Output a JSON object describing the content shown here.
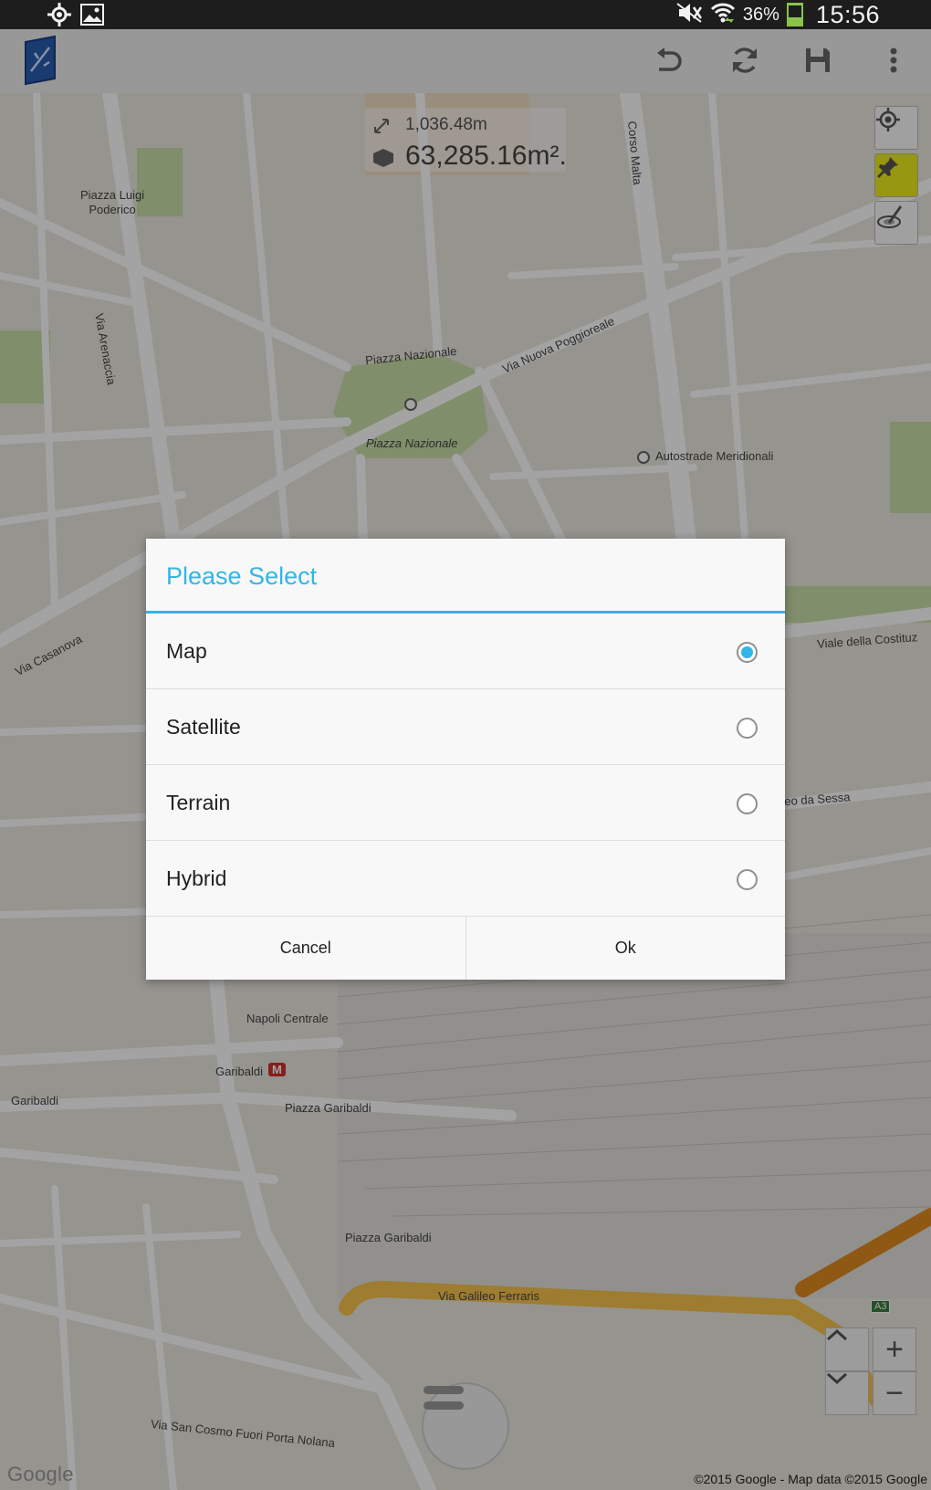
{
  "status_bar": {
    "battery_percent": "36%",
    "battery_level": 0.36,
    "time": "15:56"
  },
  "action_bar": {
    "icons": [
      "app-icon",
      "undo-icon",
      "refresh-icon",
      "save-icon",
      "overflow-menu-icon"
    ]
  },
  "map": {
    "measurement": {
      "length": "1,036.48m",
      "area": "63,285.16m²."
    },
    "labels": {
      "piazza_luigi_poderico": "Piazza Luigi\nPoderico",
      "via_arenaccia": "Via Arenaccia",
      "corso_malta": "Corso Malta",
      "piazza_nazionale_road": "Piazza Nazionale",
      "piazza_nazionale_park": "Piazza Nazionale",
      "via_nuova_poggioreale": "Via Nuova Poggioreale",
      "autostrade_meridionali": "Autostrade Meridionali",
      "via_casanova": "Via Casanova",
      "viale_della_costituzione": "Viale della Costituz",
      "deo_da_sessa": "deo da Sessa",
      "napoli_centrale": "Napoli Centrale",
      "garibaldi_metro": "Garibaldi",
      "garibaldi_left": "Garibaldi",
      "piazza_garibaldi_1": "Piazza Garibaldi",
      "piazza_garibaldi_2": "Piazza Garibaldi",
      "via_galileo_ferraris": "Via Galileo Ferraris",
      "via_san_cosmo": "Via San Cosmo Fuori Porta Nolana",
      "a3": "A3",
      "metro_m": "M",
      "google_logo": "Google",
      "copyright": "©2015 Google - Map data ©2015 Google"
    },
    "zoom_in_symbol": "+",
    "zoom_out_symbol": "−"
  },
  "dialog": {
    "title": "Please Select",
    "options": [
      {
        "label": "Map",
        "checked": true
      },
      {
        "label": "Satellite",
        "checked": false
      },
      {
        "label": "Terrain",
        "checked": false
      },
      {
        "label": "Hybrid",
        "checked": false
      }
    ],
    "cancel_label": "Cancel",
    "ok_label": "Ok"
  },
  "colors": {
    "accent": "#33b5e5",
    "status_bar": "#1d1d1d",
    "battery": "#8bc34a",
    "park": "#c8dfa8",
    "road": "#ffffff",
    "highway": "#f7c24b",
    "motorway": "#e08a1e",
    "active_tool": "#ecec1b"
  }
}
